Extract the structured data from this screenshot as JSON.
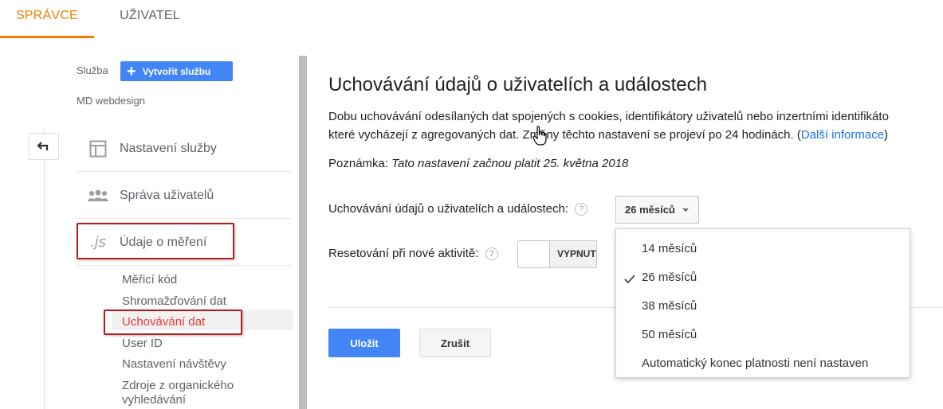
{
  "tabs": {
    "admin": "SPRÁVCE",
    "user": "UŽIVATEL"
  },
  "accent": "#f57c00",
  "sidebar": {
    "property_label": "Služba",
    "create_button": "Vytvořit službu",
    "site_name": "MD webdesign",
    "items": [
      {
        "label": "Nastavení služby",
        "icon": "layout-icon"
      },
      {
        "label": "Správa uživatelů",
        "icon": "people-icon"
      },
      {
        "label": "Údaje o měření",
        "icon": "js-icon",
        "icon_text": ".js"
      }
    ],
    "sub_items": [
      "Měřicí kód",
      "Shromažďování dat",
      "Uchovávání dat",
      "User ID",
      "Nastavení návštěvy",
      "Zdroje z organického",
      "vyhledávání"
    ],
    "active_sub": "Uchovávání dat"
  },
  "main": {
    "title": "Uchovávání údajů o uživatelích a událostech",
    "desc_line1": "Dobu uchovávání odesílaných dat spojených s cookies, identifikátory uživatelů nebo inzertními identifikáto",
    "desc_line2": "které vycházejí z agregovaných dat. Změny těchto nastavení se projeví po 24 hodinách. (",
    "desc_link": "Další informace",
    "desc_end": ")",
    "note_label": "Poznámka:",
    "note_text": "Tato nastavení začnou platit 25. května 2018",
    "retention_label": "Uchovávání údajů o uživatelích a událostech:",
    "retention_value": "26 měsíců",
    "reset_label": "Resetování při nové aktivitě:",
    "reset_state": "VYPNUTO",
    "help": "?",
    "save": "Uložit",
    "cancel": "Zrušit"
  },
  "dropdown": {
    "options": [
      "14 měsíců",
      "26 měsíců",
      "38 měsíců",
      "50 měsíců",
      "Automatický konec platnosti není nastaven"
    ],
    "selected": "26 měsíců"
  }
}
